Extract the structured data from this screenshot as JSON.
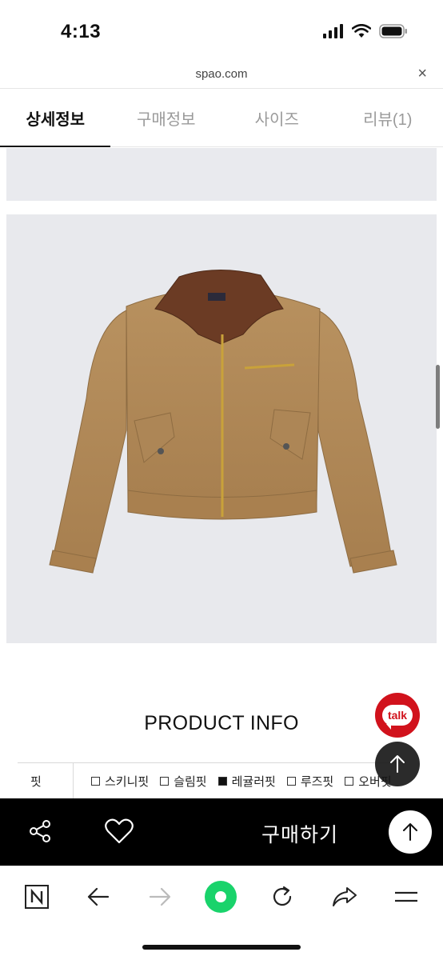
{
  "status_bar": {
    "time": "4:13"
  },
  "url_bar": {
    "domain": "spao.com",
    "close_icon": "×"
  },
  "tabs": [
    {
      "label": "상세정보",
      "active": true
    },
    {
      "label": "구매정보",
      "active": false
    },
    {
      "label": "사이즈",
      "active": false
    },
    {
      "label": "리뷰(1)",
      "active": false
    }
  ],
  "product": {
    "image_subject": "brown cropped work jacket with corduroy collar",
    "info_title": "PRODUCT INFO",
    "fit": {
      "label": "핏",
      "options": [
        {
          "label": "스키니핏",
          "checked": false
        },
        {
          "label": "슬림핏",
          "checked": false
        },
        {
          "label": "레귤러핏",
          "checked": true
        },
        {
          "label": "루즈핏",
          "checked": false
        },
        {
          "label": "오버핏",
          "checked": false
        }
      ]
    }
  },
  "floating": {
    "talk_label": "talk"
  },
  "purchase_bar": {
    "buy_label": "구매하기"
  },
  "browser_toolbar": {
    "icons": [
      "naver-n-icon",
      "back-arrow-icon",
      "forward-arrow-icon",
      "green-dot-icon",
      "reload-icon",
      "share-arrow-icon",
      "menu-icon"
    ]
  },
  "colors": {
    "accent_red": "#d1121c",
    "green_home": "#19d36b",
    "purchase_bar": "#000000"
  }
}
